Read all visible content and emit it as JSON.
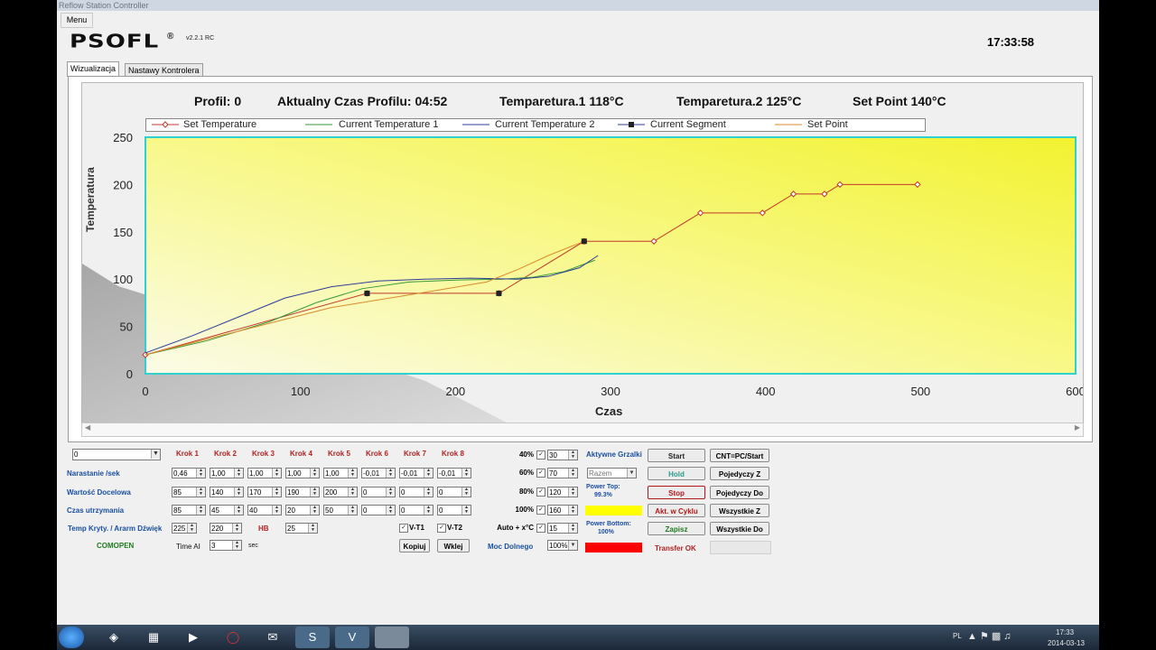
{
  "window": {
    "title": "Reflow Station Controller",
    "menu": "Menu"
  },
  "header": {
    "logo": "PSOFL",
    "logo_mark": "®",
    "version": "v2.2.1 RC",
    "clock": "17:33:58"
  },
  "tabs": [
    {
      "label": "Wizualizacja"
    },
    {
      "label": "Nastawy Kontrolera"
    }
  ],
  "status": {
    "profile": "Profil: 0",
    "profile_time": "Aktualny Czas Profilu: 04:52",
    "temp1": "Temparetura.1  118°C",
    "temp2": "Temparetura.2  125°C",
    "setpoint": "Set Point 140°C"
  },
  "chart_data": {
    "type": "line",
    "xlabel": "Czas",
    "ylabel": "Temperatura",
    "xlim": [
      0,
      600
    ],
    "ylim": [
      0,
      250
    ],
    "xticks": [
      0,
      100,
      200,
      300,
      400,
      500,
      600
    ],
    "yticks": [
      0,
      50,
      100,
      150,
      200,
      250
    ],
    "grid": false,
    "legend_position": "top",
    "legend": [
      "Set Temperature",
      "Current Temperature 1",
      "Current Temperature 2",
      "Current Segment",
      "Set Point"
    ],
    "series": [
      {
        "name": "Set Temperature",
        "color": "#c0392b",
        "marker": "diamond",
        "x": [
          0,
          143,
          228,
          283,
          328,
          358,
          398,
          418,
          438,
          448,
          498
        ],
        "y": [
          20,
          85,
          85,
          140,
          140,
          170,
          170,
          190,
          190,
          200,
          200
        ]
      },
      {
        "name": "Current Temperature 1",
        "color": "#3a9a3a",
        "x": [
          0,
          40,
          80,
          110,
          140,
          170,
          200,
          230,
          250,
          270,
          290
        ],
        "y": [
          20,
          35,
          55,
          75,
          90,
          97,
          99,
          100,
          102,
          108,
          120
        ]
      },
      {
        "name": "Current Temperature 2",
        "color": "#2c3e9a",
        "x": [
          0,
          30,
          60,
          90,
          120,
          150,
          180,
          210,
          240,
          260,
          280,
          292
        ],
        "y": [
          22,
          40,
          60,
          80,
          92,
          98,
          100,
          101,
          100,
          103,
          112,
          125
        ]
      },
      {
        "name": "Set Point",
        "color": "#d98a2c",
        "x": [
          0,
          60,
          120,
          180,
          220,
          240,
          260,
          283
        ],
        "y": [
          20,
          45,
          70,
          86,
          97,
          110,
          125,
          140
        ]
      }
    ],
    "current_segment": {
      "name": "Current Segment",
      "x": [
        143,
        228,
        283
      ],
      "y": [
        85,
        85,
        140
      ]
    }
  },
  "controls": {
    "profile_select": "0",
    "steps": [
      "Krok 1",
      "Krok 2",
      "Krok 3",
      "Krok 4",
      "Krok 5",
      "Krok 6",
      "Krok 7",
      "Krok 8"
    ],
    "rows": [
      {
        "label": "Narastanie /sek",
        "values": [
          "0,46",
          "1,00",
          "1,00",
          "1,00",
          "1,00",
          "-0,01",
          "-0,01",
          "-0,01"
        ]
      },
      {
        "label": "Wartość Docelowa",
        "values": [
          "85",
          "140",
          "170",
          "190",
          "200",
          "0",
          "0",
          "0"
        ]
      },
      {
        "label": "Czas utrzymania",
        "values": [
          "85",
          "45",
          "40",
          "20",
          "50",
          "0",
          "0",
          "0"
        ]
      }
    ],
    "alarm_label": "Temp Kryty. / Ararm Dźwięk",
    "alarm_values": [
      "225",
      "220"
    ],
    "hb_label": "HB",
    "hb_value": "25",
    "vt1": "V-T1",
    "vt2": "V-T2",
    "comopen": "COMOPEN",
    "time_label": "Time AI",
    "time_value": "3",
    "time_unit": "sec",
    "copy_btn": "Kopiuj",
    "paste_btn": "Wklej",
    "pct": [
      {
        "label": "40%",
        "value": "30"
      },
      {
        "label": "60%",
        "value": "70"
      },
      {
        "label": "80%",
        "value": "120"
      },
      {
        "label": "100%",
        "value": "160"
      },
      {
        "label": "Auto + x°C",
        "value": "15"
      }
    ],
    "moc_label": "Moc Dolnego",
    "moc_value": "100%",
    "heaters_label": "Aktywne Grzalki",
    "heaters_select": "Razem",
    "power_top": "Power Top:",
    "power_top_val": "99.3%",
    "power_bottom": "Power Bottom:",
    "power_bottom_val": "100%",
    "transfer": "Transfer OK",
    "buttons": {
      "start": "Start",
      "hold": "Hold",
      "stop": "Stop",
      "akt": "Akt. w Cyklu",
      "zapisz": "Zapisz",
      "cnt": "CNT=PC/Start",
      "pz": "Pojedyczy Z",
      "pd": "Pojedyczy Do",
      "wz": "Wszystkie Z",
      "wd": "Wszystkie Do"
    }
  },
  "taskbar": {
    "lang": "PL",
    "time": "17:33",
    "date": "2014-03-13"
  }
}
